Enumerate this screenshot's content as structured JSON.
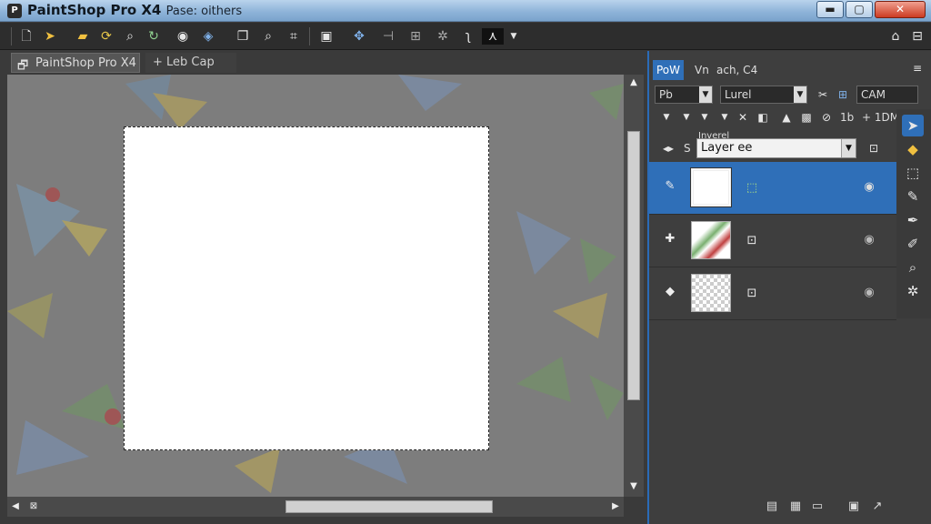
{
  "window": {
    "app_icon": "paintshop-app-icon",
    "title": "PaintShop Pro X4",
    "subtitle": "Pase: oithers",
    "controls": {
      "minimize": "▬",
      "maximize": "▢",
      "close": "✕"
    }
  },
  "toolbar": {
    "icons": [
      "new-icon",
      "open-icon",
      "folder-icon",
      "refresh-icon",
      "search-zoom-icon",
      "rotate-icon",
      "circle-icon",
      "layers-icon",
      "copy-icon",
      "search-icon",
      "crop-icon",
      "arrange-icon",
      "move-icon",
      "align-icon",
      "transform-icon",
      "gear-icon",
      "brush-icon",
      "text-icon"
    ],
    "right_icons": [
      "camera-icon",
      "collapse-icon"
    ]
  },
  "document_tabs": [
    {
      "label": "PaintShop Pro X4",
      "active": true
    },
    {
      "label": "+ Leb Cap",
      "active": false
    }
  ],
  "panel": {
    "tabs": [
      {
        "label": "PoW",
        "active": true
      },
      {
        "label": "Vn",
        "active": false
      },
      {
        "label": "ach, C4",
        "active": false
      }
    ],
    "row1": {
      "tool_label": "Pb",
      "blend_value": "Lurel",
      "mode_value": "CAM"
    },
    "row2": {
      "values": [
        "1b",
        "+ 1DM"
      ]
    },
    "layer_section_label": "Inverel",
    "layer_dropdown": "Layer ee",
    "s_label": "S",
    "layers": [
      {
        "type": "vector",
        "selected": true
      },
      {
        "type": "raster",
        "selected": false
      },
      {
        "type": "mask",
        "selected": false
      }
    ],
    "tools": [
      "pointer-icon",
      "fill-icon",
      "select-icon",
      "brush-icon",
      "pen-icon",
      "dropper-icon",
      "magnify-icon",
      "gear-icon"
    ]
  },
  "colors": {
    "accent": "#2f6fb8",
    "titlebar": "#8fb4d9",
    "panel_bg": "#3e3e3e"
  }
}
